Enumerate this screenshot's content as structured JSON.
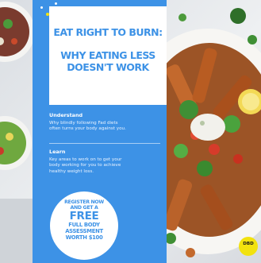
{
  "poster": {
    "headline_line1": "EAT RIGHT TO BURN:",
    "headline_line2a": "WHY EATING LESS",
    "headline_line2b": "DOESN'T WORK",
    "section1_title": "Understand",
    "section1_line1": "Why blindly following Fad diets",
    "section1_line2": "often turns your body against you.",
    "section2_title": "Learn",
    "section2_line1": "Key areas to work on to get your",
    "section2_line2": "body working for you to achieve",
    "section2_line3": "healthy weight loss.",
    "offer_line1": "REGISTER NOW",
    "offer_line2": "AND GET A",
    "offer_line3": "FREE",
    "offer_line4": "FULL BODY",
    "offer_line5": "ASSESSMENT",
    "offer_line6": "WORTH $100",
    "badge_line1": "DBD"
  },
  "colors": {
    "brand_blue": "#3d92e6",
    "badge_yellow": "#f2e20e",
    "white": "#ffffff"
  }
}
